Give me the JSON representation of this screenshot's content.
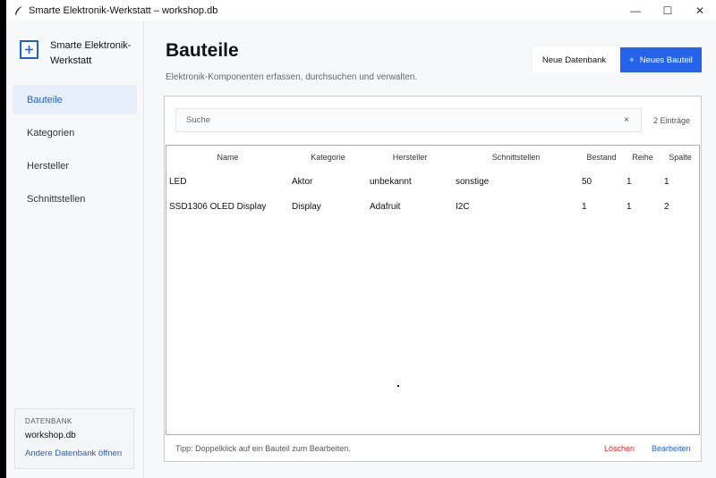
{
  "window": {
    "title": "Smarte Elektronik-Werkstatt – workshop.db",
    "minimize": "—",
    "maximize": "☐",
    "close": "✕"
  },
  "sidebar": {
    "brand": "Smarte Elektronik-Werkstatt",
    "brand_icon": "plus-square-icon",
    "items": [
      {
        "label": "Bauteile",
        "active": true
      },
      {
        "label": "Kategorien",
        "active": false
      },
      {
        "label": "Hersteller",
        "active": false
      },
      {
        "label": "Schnittstellen",
        "active": false
      }
    ],
    "database": {
      "label": "DATENBANK",
      "name": "workshop.db",
      "open_link": "Andere Datenbank öffnen"
    }
  },
  "header": {
    "title": "Bauteile",
    "subtitle": "Elektronik-Komponenten erfassen, durchsuchen und verwalten.",
    "new_db_button": "Neue Datenbank",
    "new_part_button": "Neues Bauteil",
    "new_part_plus": "+"
  },
  "search": {
    "placeholder": "Suche",
    "value": "",
    "clear": "×",
    "count": "2 Einträge"
  },
  "table": {
    "columns": [
      "Name",
      "Kategorie",
      "Hersteller",
      "Schnittstellen",
      "Bestand",
      "Reihe",
      "Spalte"
    ],
    "rows": [
      [
        "LED",
        "Aktor",
        "unbekannt",
        "sonstige",
        "50",
        "1",
        "1"
      ],
      [
        "SSD1306 OLED Display",
        "Display",
        "Adafruit",
        "I2C",
        "1",
        "1",
        "2"
      ]
    ]
  },
  "footer": {
    "tip": "Tipp: Doppelklick auf ein Bauteil zum Bearbeiten.",
    "delete": "Löschen",
    "edit": "Bearbeiten"
  },
  "colors": {
    "accent": "#2563eb",
    "danger": "#dc2626",
    "active_nav_bg": "#e7eefc"
  }
}
